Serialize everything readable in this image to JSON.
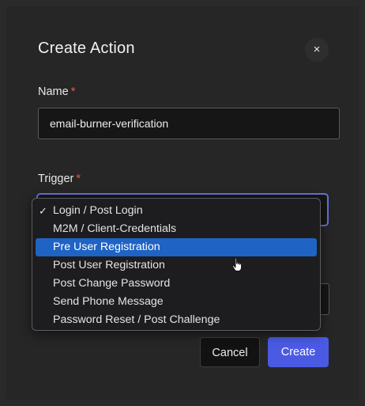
{
  "dialog": {
    "title": "Create Action",
    "close_symbol": "×",
    "required_mark": "*"
  },
  "name_field": {
    "label": "Name",
    "value": "email-burner-verification"
  },
  "trigger_field": {
    "label": "Trigger",
    "options": [
      {
        "label": "Login / Post Login",
        "checked": true,
        "highlighted": false
      },
      {
        "label": "M2M / Client-Credentials",
        "checked": false,
        "highlighted": false
      },
      {
        "label": "Pre User Registration",
        "checked": false,
        "highlighted": true
      },
      {
        "label": "Post User Registration",
        "checked": false,
        "highlighted": false
      },
      {
        "label": "Post Change Password",
        "checked": false,
        "highlighted": false
      },
      {
        "label": "Send Phone Message",
        "checked": false,
        "highlighted": false
      },
      {
        "label": "Password Reset / Post Challenge",
        "checked": false,
        "highlighted": false
      }
    ],
    "check_symbol": "✓"
  },
  "buttons": {
    "cancel": "Cancel",
    "create": "Create"
  },
  "icons": {
    "close": "close-icon",
    "check": "checkmark-icon",
    "cursor": "hand-pointer-cursor-icon"
  },
  "colors": {
    "accent": "#4a5ae3",
    "focus_border": "#6671d8",
    "selection": "#1f63c4",
    "required": "#e05b4f"
  }
}
